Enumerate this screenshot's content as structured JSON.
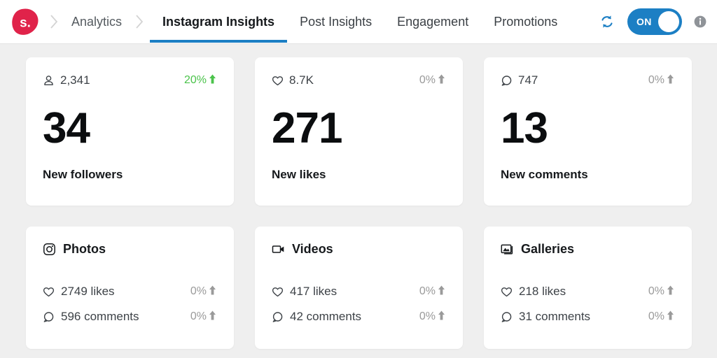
{
  "header": {
    "logo_text": "s.",
    "logo_color": "#e0234a",
    "breadcrumb": {
      "label": "Analytics"
    },
    "tabs": [
      {
        "label": "Instagram Insights",
        "active": true
      },
      {
        "label": "Post Insights",
        "active": false
      },
      {
        "label": "Engagement",
        "active": false
      },
      {
        "label": "Promotions",
        "active": false
      }
    ],
    "active_tab_color": "#1c7fc4",
    "refresh_icon": "refresh-icon",
    "toggle": {
      "label": "ON",
      "state": "on",
      "color": "#1c7fc4"
    },
    "info_icon": "info-icon"
  },
  "metrics": [
    {
      "total_icon": "person-icon",
      "total": "2,341",
      "delta": "20%",
      "delta_direction": "up",
      "delta_color": "#4bc34b",
      "value": "34",
      "label": "New followers"
    },
    {
      "total_icon": "heart-icon",
      "total": "8.7K",
      "delta": "0%",
      "delta_direction": "up",
      "delta_color": "#9a9a9a",
      "value": "271",
      "label": "New likes"
    },
    {
      "total_icon": "comment-icon",
      "total": "747",
      "delta": "0%",
      "delta_direction": "up",
      "delta_color": "#9a9a9a",
      "value": "13",
      "label": "New comments"
    }
  ],
  "categories": [
    {
      "icon": "instagram-icon",
      "title": "Photos",
      "stats": [
        {
          "icon": "heart-icon",
          "text": "2749 likes",
          "delta": "0%"
        },
        {
          "icon": "comment-icon",
          "text": "596 comments",
          "delta": "0%"
        }
      ]
    },
    {
      "icon": "video-camera-icon",
      "title": "Videos",
      "stats": [
        {
          "icon": "heart-icon",
          "text": "417 likes",
          "delta": "0%"
        },
        {
          "icon": "comment-icon",
          "text": "42 comments",
          "delta": "0%"
        }
      ]
    },
    {
      "icon": "gallery-icon",
      "title": "Galleries",
      "stats": [
        {
          "icon": "heart-icon",
          "text": "218 likes",
          "delta": "0%"
        },
        {
          "icon": "comment-icon",
          "text": "31 comments",
          "delta": "0%"
        }
      ]
    }
  ]
}
